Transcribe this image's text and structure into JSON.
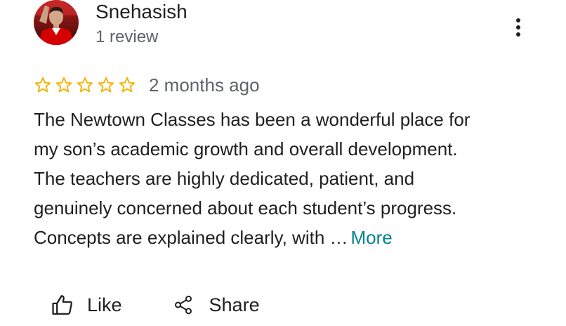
{
  "reviewer": {
    "name": "Snehasish",
    "review_count": "1 review",
    "avatar_icon": "profile-photo"
  },
  "menu": {
    "icon": "more-vert-icon"
  },
  "rating": {
    "stars": 0,
    "max_stars": 5,
    "star_color": "#f4b400",
    "date": "2 months ago"
  },
  "review": {
    "lines": [
      "The Newtown Classes has been a wonderful place for",
      "my son’s academic growth and overall development.",
      "The teachers are highly dedicated, patient, and",
      "genuinely concerned about each student’s progress.",
      "Concepts are explained clearly, with …"
    ],
    "more_label": "More",
    "more_color": "#00838f"
  },
  "actions": {
    "like_label": "Like",
    "share_label": "Share"
  }
}
